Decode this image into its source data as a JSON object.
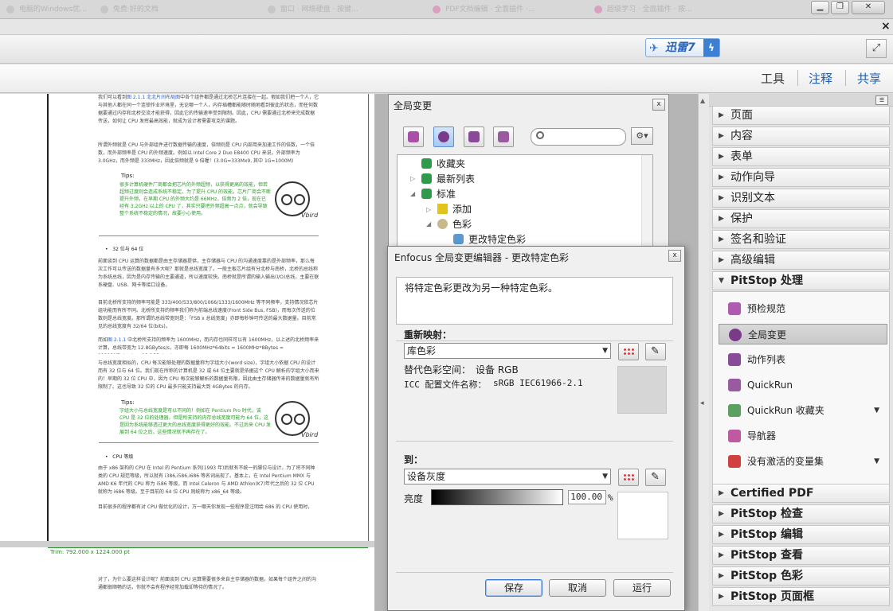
{
  "browser": {
    "tabs": [
      "电脑的Windows优...",
      "免费·好的文档",
      "窗口 · 网络硬盘 · 按键...",
      "PDF文档编辑 · 全面插件 ·...",
      "超级学习 · 全面插件 · 按..."
    ],
    "min_label": "▁",
    "restore_label": "❐",
    "close_label": "✕",
    "bar_close": "×"
  },
  "xunlei": {
    "label": "迅雷7",
    "bolt": "ϟ"
  },
  "toolbar": {
    "tools": "工具",
    "comment": "注释",
    "share": "共享"
  },
  "document": {
    "p1_pre": "我们可以看到",
    "p1_link": "图 2.1.1 北北片间布局图",
    "p1_post": "中各个组件都是通过北桥芯片连接在一起。假如我们把一个人，它与其他人都在同一个连锁作业环境里，无论哪一个人，内存插槽都能随时随地看到彼此的状态，而任何数据要通过内存和北桥交流才能获得，因此它的传输速率受到限制。因此，CPU 需要通过北桥来完成数据传送，如何让 CPU 发挥最高效能，就成为设计者需要攻克的课题。",
    "p2": "所谓外频就是 CPU 与外部组件进行数据传输的速度，倍频则是 CPU 内部用来加速工作的倍数，一个倍数，而外部频率是 CPU 的外频速度。例如以 Intel Core 2 Duo E8400 CPU 来说，外部频率为 3.0GHz，而外频是 333MHz，因此倍频就是 9 倍喔！(3.0G=333Mx9, 其中 1G=1000M)",
    "tip1_title": "Tips:",
    "tip1_body": "很多计算机硬件厂商都会把芯片的外频超频，以获得更高的效能，但若超频过度则会造成系统不稳定。为了提升 CPU 的效能，芯片厂商会不断提升外频，在早期 CPU 的外频大约是 66MHz，倍频为 2 倍，现在已经有 3.2GHz 以上的 CPU 了，其实只要把外频超高一点点，就会导致整个系统不稳定的情况，故要小心使用。",
    "sig": "Vbird",
    "bullet1": "32 位与 64 位",
    "p3": "前面谈到 CPU 运算的数据都是由主存储器提供，主存储器与 CPU 的沟通速度靠的是外部频率，那么每次工作可以传送的数据量有多大呢？那就是总线宽度了。一般主板芯片组有分北桥与南桥，北桥的总线称为系统总线，因为是内存传输的主要通道，所以速度较快。南桥就是所谓的输入输出(I/O)总线，主要在联系硬盘、USB、网卡等接口设备。",
    "p4": "目前北桥所支持的频率可能是 333/400/533/800/1066/1333/1600MHz 等不同频率，支持情况依芯片组功能而有所不同。北桥所支持的频率我们称为前端总线速度(Front Side Bus, FSB)，而每次传送的位数则是总线宽度。那所谓的总线带宽则是：「FSB x 总线宽度」亦即每秒钟可传送的最大数据量。目前常见的总线宽度有 32/64 位(bits)。",
    "p5_pre": "而如",
    "p5_link": "图 2.1.1",
    "p5_post": " 中北桥所支持的频率为 1600MHz，而内存也同样可以有 1600MHz，以上述的北桥频率来计算，总线带宽为 12.8GBytes/s，亦即每 1600MHz*64bits = 1600MHz*8Bytes = 12800MBytes/s = 12.8GBytes/s",
    "p6": "与总线宽度相似的，CPU 每次能够处理的数据量称为字组大小(word size)，字组大小依据 CPU 的设计而有 32 位与 64 位。我们现在所称的计算机是 32 或 64 位主要就是依据这个 CPU 解析的字组大小而来的！早期的 32 位 CPU 中，因为 CPU 每次能够解析的数据量有限，因此由主存储器传来的数据量就有所限制了。这也导致 32 位的 CPU 最多只能支持最大到 4GBytes 的内存。",
    "tip2_title": "Tips:",
    "tip2_body": "字组大小与总线宽度是可以不同的！例如在 Pentium Pro 时代，该 CPU 是 32 位的处理器，但是所支持的内存总线宽度可能为 64 位，这是因为系统能够透过更大的总线宽度获得更好的效能。不过后来 CPU 发展到 64 位之后，这些情况就不再存在了。",
    "bullet2": "CPU 等级",
    "p7": "由于 x86 架构的 CPU 在 Intel 的 Pentium 系列(1993 年)后就有不统一的脚位与设计，为了将不同种类的 CPU 规范等级，所以就有 i386,i586,i686 等名词出现了。基本上，在 Intel Pentium MMX 与 AMD K6 年代的 CPU 称为 i586 等级，而 Intel Celeron 与 AMD Athlon(K7)年代之后的 32 位 CPU 就称为 i686 等级。至于目前的 64 位 CPU 则统称为 x86_64 等级。",
    "p8": "目前很多的程序都有对 CPU 做优化的设计，万一哪天你发现一些程序是注明给 686 的 CPU 使用时，",
    "trim": "Trim: 792.000 x 1224.000 pt",
    "p9": "对了，为什么要这样设计呢？前面谈到 CPU 运算需要很多来自主存储器的数据，如果每个组件之间的沟通都很顺畅的话，你就不会有程序经常加载却等待的情况了。"
  },
  "global_panel": {
    "title": "全局变更",
    "close": "x",
    "menu_icon": "⚙▾",
    "tree": [
      {
        "label": "收藏夹"
      },
      {
        "label": "最新列表"
      },
      {
        "label": "标准"
      },
      {
        "label": "添加"
      },
      {
        "label": "色彩"
      },
      {
        "label": "更改特定色彩"
      }
    ]
  },
  "dialog": {
    "title": "Enfocus 全局变更编辑器 - 更改特定色彩",
    "close": "x",
    "description": "将特定色彩更改为另一种特定色彩。",
    "remap_label": "重新映射：",
    "remap_value": "库色彩",
    "alt_space_label": "替代色彩空间：",
    "alt_space_value": "设备 RGB",
    "icc_label": "ICC 配置文件名称：",
    "icc_value": "sRGB IEC61966-2.1",
    "to_label": "到：",
    "to_value": "设备灰度",
    "brightness_label": "亮度",
    "brightness_value": "100.00",
    "pct": "%",
    "save": "保存",
    "cancel": "取消",
    "run": "运行"
  },
  "right_panel": {
    "sections_top": [
      "页面",
      "内容",
      "表单",
      "动作向导",
      "识别文本",
      "保护",
      "签名和验证",
      "高级编辑"
    ],
    "pitstop_header": "PitStop 处理",
    "pitstop_items": [
      {
        "label": "预检规范",
        "icon": "checkmark-icon"
      },
      {
        "label": "全局变更",
        "icon": "globe-icon"
      },
      {
        "label": "动作列表",
        "icon": "gear-icon"
      },
      {
        "label": "QuickRun",
        "icon": "funnel-icon"
      },
      {
        "label": "QuickRun 收藏夹",
        "icon": "funnel-star-icon"
      },
      {
        "label": "导航器",
        "icon": "warning-icon"
      },
      {
        "label": "没有激活的变量集",
        "icon": "variable-icon"
      }
    ],
    "sections_bottom": [
      "Certified PDF",
      "PitStop 检查",
      "PitStop 编辑",
      "PitStop 查看",
      "PitStop 色彩",
      "PitStop 页面框"
    ]
  },
  "colors": {
    "accent_blue": "#1d5fae",
    "green_text": "#2a9a2a",
    "link_blue": "#2a5fd4"
  }
}
